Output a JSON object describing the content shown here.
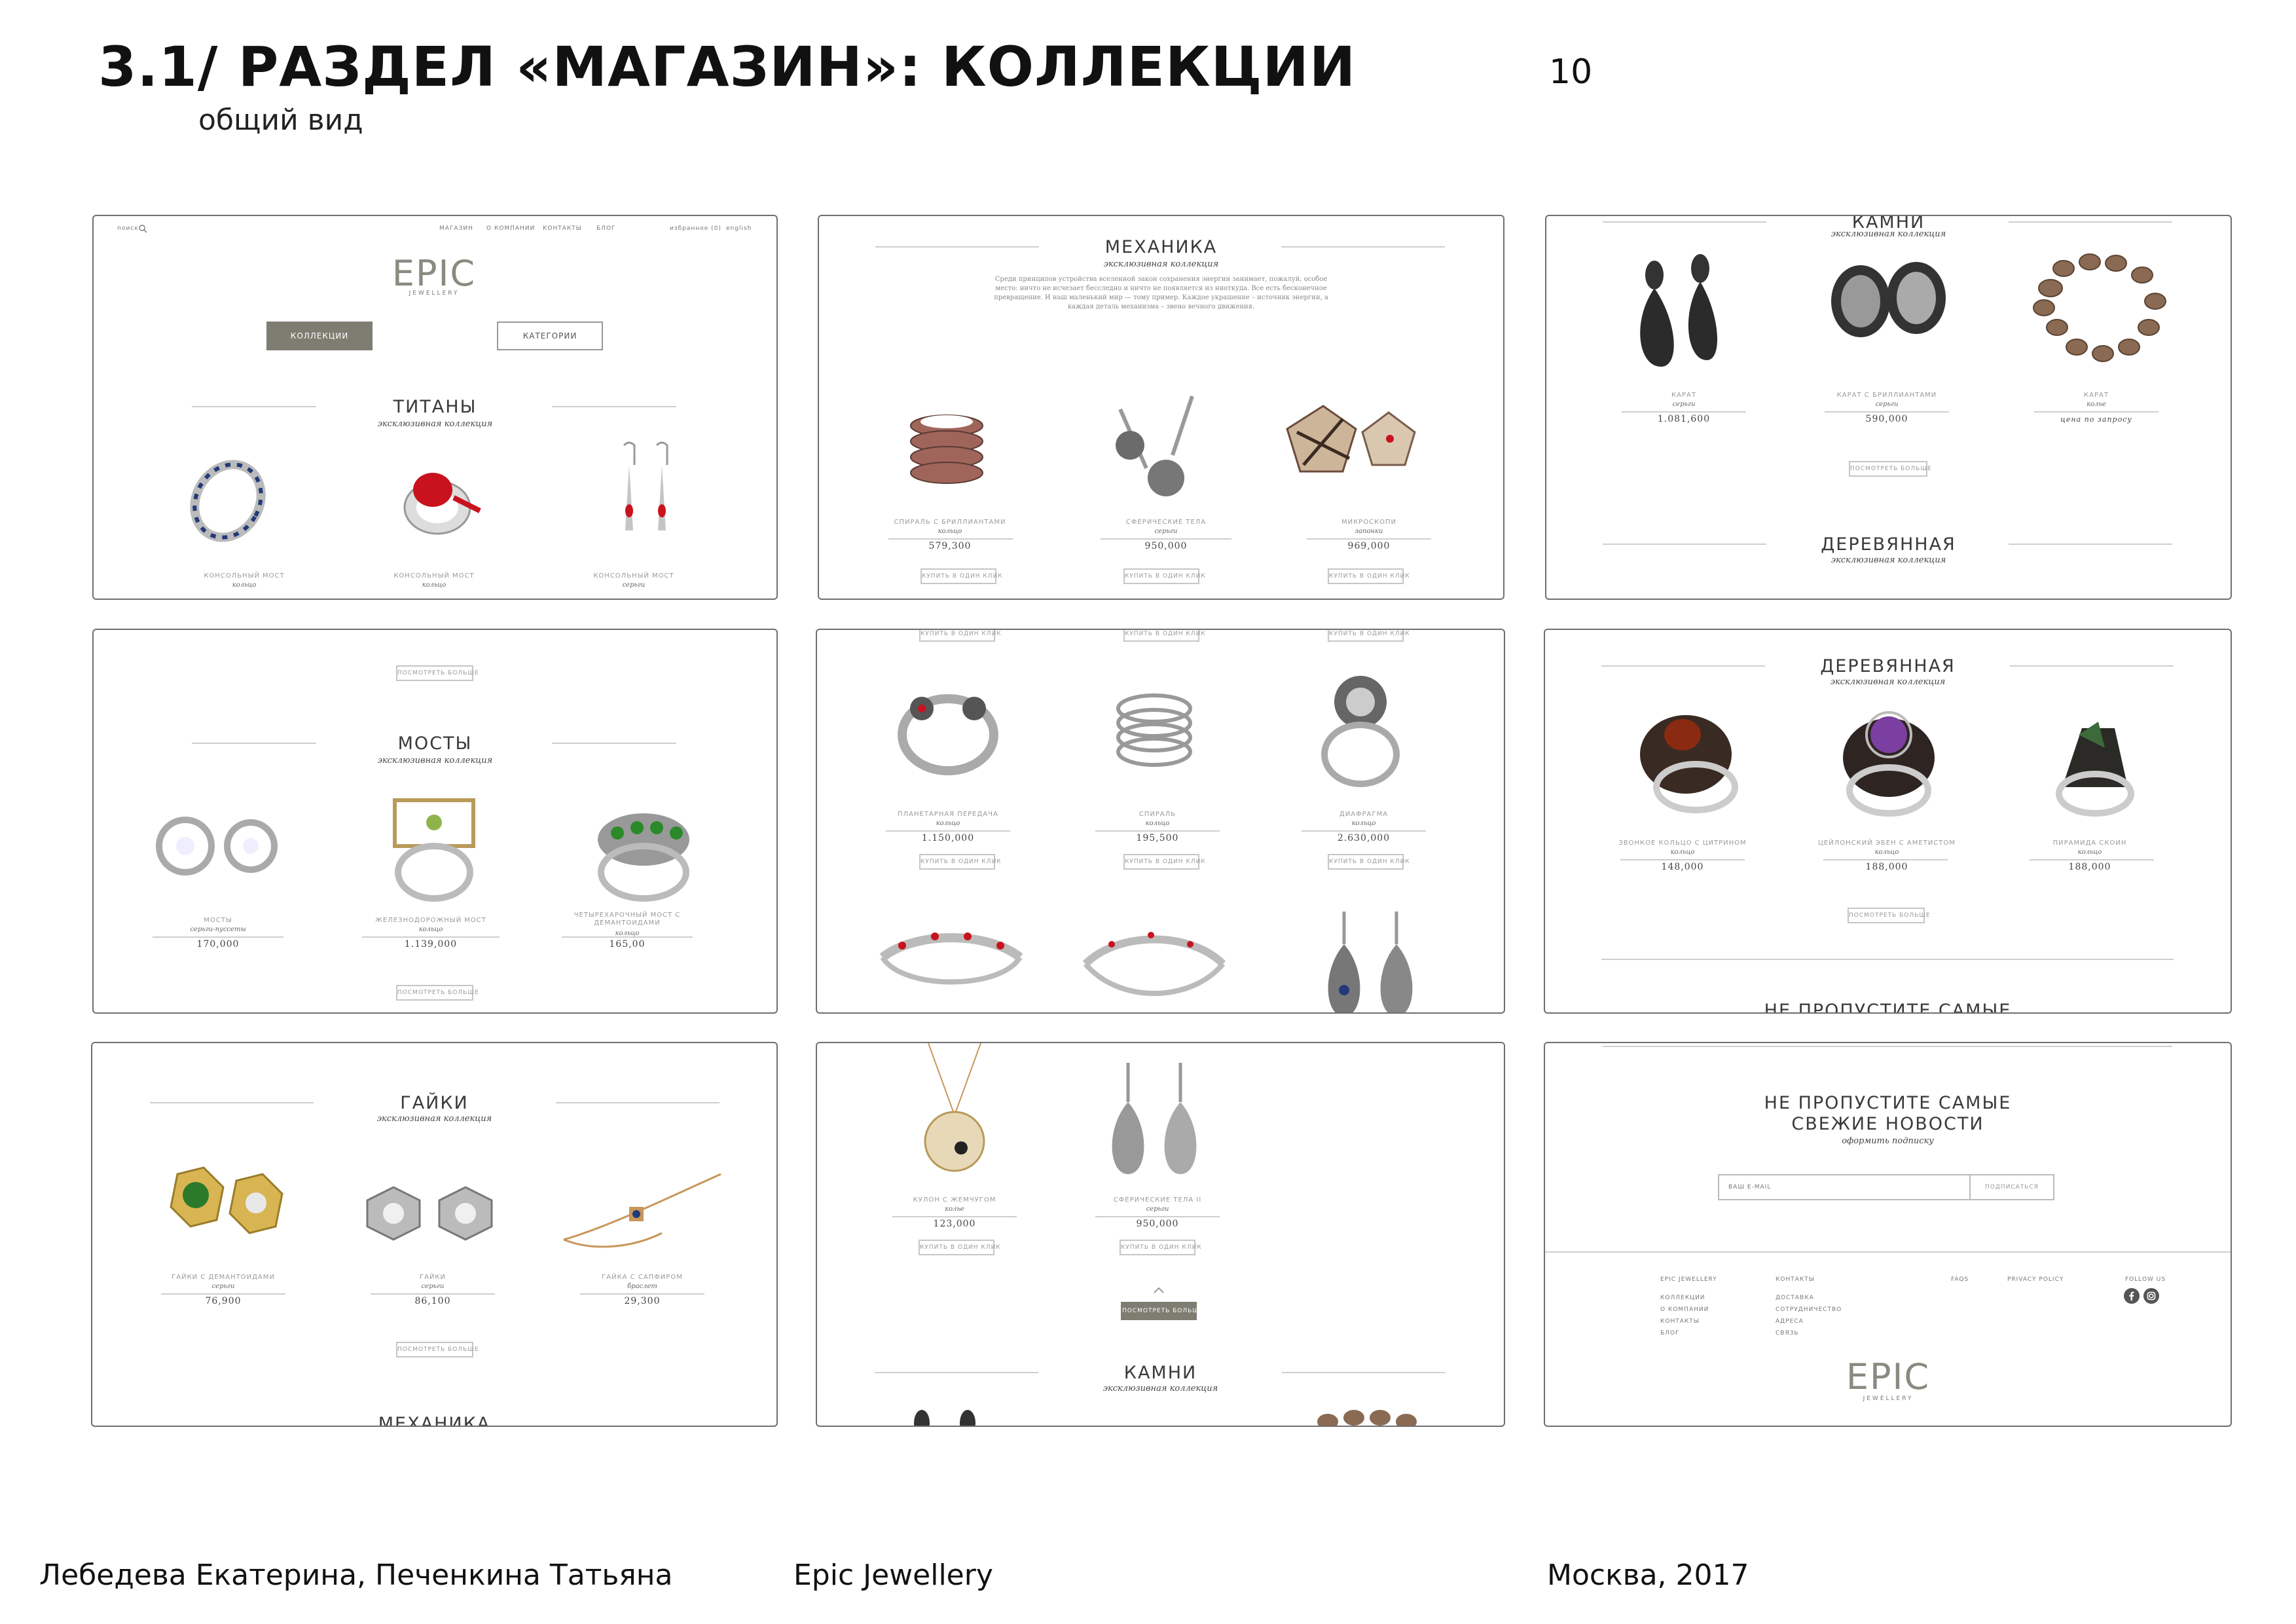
{
  "header": {
    "title": "3.1/ РАЗДЕЛ «МАГАЗИН»: КОЛЛЕКЦИИ",
    "subtitle": "общий вид",
    "page_number": "10"
  },
  "footer": {
    "authors": "Лебедева Екатерина, Печенкина Татьяна",
    "project": "Epic Jewellery",
    "city_year": "Москва, 2017"
  },
  "common": {
    "sub": "эксклюзивная коллекция",
    "more": "ПОСМОТРЕТЬ БОЛЬШЕ",
    "buy": "КУПИТЬ В ОДИН КЛИК"
  },
  "s1": {
    "search": "поиск",
    "nav": [
      "МАГАЗИН",
      "О КОМПАНИИ",
      "КОНТАКТЫ",
      "БЛОГ"
    ],
    "wishlist": "избранное (0)",
    "lang": "english",
    "logo": "EPIC",
    "logo_sub": "JEWELLERY",
    "btn_collections": "КОЛЛЕКЦИИ",
    "btn_categories": "КАТЕГОРИИ",
    "title": "ТИТАНЫ",
    "labels": [
      "КОНСОЛЬНЫЙ МОСТ",
      "КОНСОЛЬНЫЙ МОСТ",
      "КОНСОЛЬНЫЙ МОСТ"
    ],
    "kinds": [
      "кольцо",
      "кольцо",
      "серьги"
    ]
  },
  "s2": {
    "title": "МЕХАНИКА",
    "paragraph": "Среди принципов устройства вселенной закон сохранения энергии занимает, пожалуй, особое место: ничто не исчезает бесследно и ничто не появляется из ниоткуда. Все есть бесконечное превращение. И наш маленький мир — тому пример. Каждое украшение – источник энергии, а каждая деталь механизма – звено вечного движения.",
    "labels": [
      "СПИРАЛЬ С БРИЛЛИАНТАМИ",
      "СФЕРИЧЕСКИЕ ТЕЛА",
      "МИКРОСКОПИ"
    ],
    "kinds": [
      "кольцо",
      "серьги",
      "запонки"
    ],
    "prices": [
      "579,300",
      "950,000",
      "969,000"
    ]
  },
  "s3": {
    "title": "КАМНИ",
    "labels": [
      "КАРАТ",
      "КАРАТ С БРИЛЛИАНТАМИ",
      "КАРАТ"
    ],
    "kinds": [
      "серьги",
      "серьги",
      "колье"
    ],
    "prices": [
      "1.081,600",
      "590,000",
      "цена по запросу"
    ],
    "title2": "ДЕРЕВЯННАЯ"
  },
  "s4": {
    "title": "МОСТЫ",
    "labels": [
      "МОСТЫ",
      "ЖЕЛЕЗНОДОРОЖНЫЙ МОСТ",
      "ЧЕТЫРЕХАРОЧНЫЙ МОСТ С ДЕМАНТОИДАМИ"
    ],
    "kinds": [
      "серьги-пуссеты",
      "кольцо",
      "кольцо"
    ],
    "prices": [
      "170,000",
      "1.139,000",
      "165,00"
    ]
  },
  "s5": {
    "labels": [
      "ПЛАНЕТАРНАЯ ПЕРЕДАЧА",
      "СПИРАЛЬ",
      "ДИАФРАГМА"
    ],
    "kinds": [
      "кольцо",
      "кольцо",
      "кольцо"
    ],
    "prices": [
      "1.150,000",
      "195,500",
      "2.630,000"
    ]
  },
  "s6": {
    "title": "ДЕРЕВЯННАЯ",
    "labels": [
      "ЗВОНКОЕ КОЛЬЦО С ЦИТРИНОМ",
      "ЦЕЙЛОНСКИЙ ЭБЕН С АМЕТИСТОМ",
      "ПИРАМИДА СКОИН"
    ],
    "kinds": [
      "кольцо",
      "кольцо",
      "кольцо"
    ],
    "prices": [
      "148,000",
      "188,000",
      "188,000"
    ],
    "news_cut": "НЕ ПРОПУСТИТЕ САМЫЕ"
  },
  "s7": {
    "title": "ГАЙКИ",
    "labels": [
      "ГАЙКИ С ДЕМАНТОИДАМИ",
      "ГАЙКИ",
      "ГАЙКА С САПФИРОМ"
    ],
    "kinds": [
      "серьги",
      "серьги",
      "браслет"
    ],
    "prices": [
      "76,900",
      "86,100",
      "29,300"
    ],
    "next": "МЕХАНИКА"
  },
  "s8": {
    "labels": [
      "КУЛОН С ЖЕМЧУГОМ",
      "СФЕРИЧЕСКИЕ ТЕЛА II"
    ],
    "kinds": [
      "колье",
      "серьги"
    ],
    "prices": [
      "123,000",
      "950,000"
    ],
    "title": "КАМНИ"
  },
  "s9": {
    "news_title1": "НЕ ПРОПУСТИТЕ САМЫЕ",
    "news_title2": "СВЕЖИЕ НОВОСТИ",
    "news_sub": "оформить подписку",
    "email_placeholder": "ВАШ E-MAIL",
    "subscribe": "ПОДПИСАТЬСЯ",
    "col1_title": "EPIC JEWELLERY",
    "col1": [
      "КОЛЛЕКЦИИ",
      "О КОМПАНИИ",
      "КОНТАКТЫ",
      "БЛОГ"
    ],
    "col2_title": "КОНТАКТЫ",
    "col2": [
      "ДОСТАВКА",
      "СОТРУДНИЧЕСТВО",
      "АДРЕСА",
      "СВЯЗЬ"
    ],
    "faqs": "FAQS",
    "privacy": "PRIVACY POLICY",
    "follow": "FOLLOW US",
    "logo": "EPIC",
    "logo_sub": "JEWELLERY"
  }
}
